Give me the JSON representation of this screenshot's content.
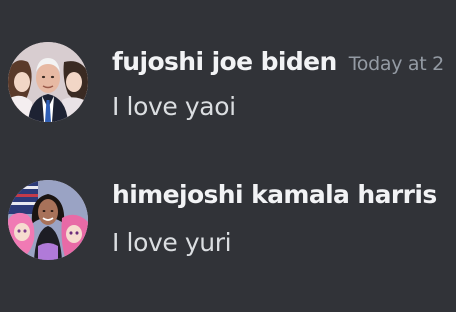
{
  "messages": [
    {
      "username": "fujoshi joe biden",
      "timestamp": "Today at 2",
      "content": "I love yaoi",
      "avatar_icon": "avatar-biden-anime-icon"
    },
    {
      "username": "himejoshi kamala harris",
      "timestamp": "",
      "content": "I love yuri",
      "avatar_icon": "avatar-harris-anime-icon"
    }
  ],
  "colors": {
    "background": "#313338",
    "username": "#f2f3f5",
    "timestamp": "#949ba4",
    "content": "#dbdee1"
  }
}
